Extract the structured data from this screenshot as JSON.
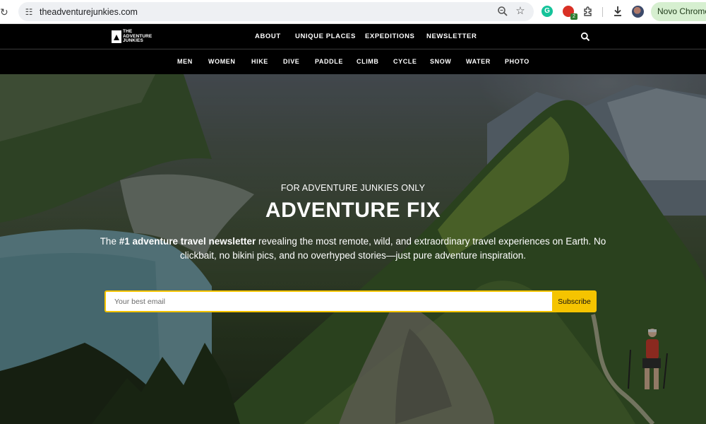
{
  "browser": {
    "url": "theadventurejunkies.com",
    "profile_button": "Novo Chrome d",
    "extension_badge": "2",
    "grammarly_letter": "G"
  },
  "site": {
    "logo_text": "THE ADVENTURE JUNKIES",
    "main_nav": [
      "ABOUT",
      "UNIQUE PLACES",
      "EXPEDITIONS",
      "NEWSLETTER"
    ],
    "categories": [
      "MEN",
      "WOMEN",
      "HIKE",
      "DIVE",
      "PADDLE",
      "CLIMB",
      "CYCLE",
      "SNOW",
      "WATER",
      "PHOTO"
    ]
  },
  "hero": {
    "kicker": "FOR ADVENTURE JUNKIES ONLY",
    "headline": "ADVENTURE FIX",
    "desc_lead": "The ",
    "desc_bold": "#1 adventure travel newsletter",
    "desc_rest": " revealing the most remote, wild, and extraordinary travel experiences on Earth. No clickbait, no bikini pics, and no overhyped stories—just pure adventure inspiration.",
    "email_placeholder": "Your best email",
    "subscribe_label": "Subscribe"
  },
  "colors": {
    "accent": "#f5c400",
    "nav_bg": "#000000",
    "profile_pill": "#d6efd0"
  }
}
